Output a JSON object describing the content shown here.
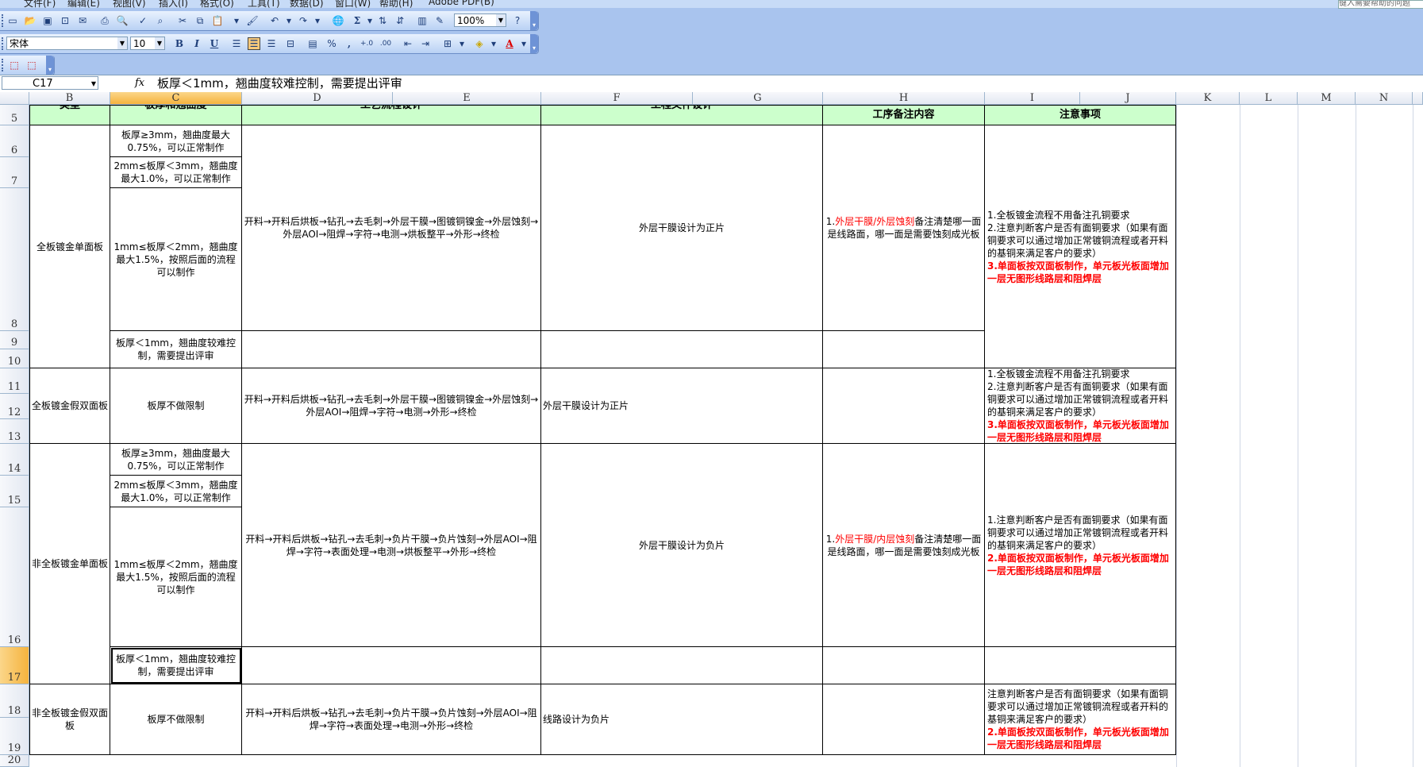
{
  "menu": {
    "items": [
      "文件(F)",
      "编辑(E)",
      "视图(V)",
      "插入(I)",
      "格式(O)",
      "工具(T)",
      "数据(D)",
      "窗口(W)",
      "帮助(H)",
      "Adobe PDF(B)"
    ],
    "help_placeholder": "键入需要帮助的问题"
  },
  "toolbar": {
    "zoom": "100%",
    "font_name": "宋体",
    "font_size": "10",
    "bold": "B",
    "italic": "I",
    "underline": "U",
    "sigma": "Σ",
    "percent": "%",
    "comma": ",",
    "inc_decimal": "+.0",
    "dec_decimal": ".00"
  },
  "formula_bar": {
    "name_box": "C17",
    "fx": "fx",
    "content": "板厚＜1mm，翘曲度较难控制，需要提出评审"
  },
  "columns": [
    "B",
    "C",
    "D",
    "E",
    "F",
    "G",
    "H",
    "I",
    "J",
    "K",
    "L",
    "M",
    "N"
  ],
  "rows": [
    "5",
    "6",
    "7",
    "8",
    "9",
    "10",
    "11",
    "12",
    "13",
    "14",
    "15",
    "16",
    "17",
    "18",
    "19",
    "20"
  ],
  "header": {
    "type": "类型",
    "thickness": "板厚和翘曲度",
    "process": "工艺流程设计",
    "eng": "工程文件设计",
    "remark": "工序备注内容",
    "notes": "注意事项"
  },
  "group1": {
    "type": "全板镀金单面板",
    "t1": "板厚≥3mm，翘曲度最大0.75%，可以正常制作",
    "t2": "2mm≤板厚＜3mm，翘曲度最大1.0%，可以正常制作",
    "t3": "1mm≤板厚＜2mm，翘曲度最大1.5%，按照后面的流程可以制作",
    "t4": "板厚＜1mm，翘曲度较难控制，需要提出评审",
    "process": "开料→开料后烘板→钻孔→去毛刺→外层干膜→图镀铜镍金→外层蚀刻→外层AOI→阻焊→字符→电测→烘板整平→外形→终检",
    "eng": "外层干膜设计为正片",
    "remark_prefix": "1.",
    "remark_red": "外层干膜/外层蚀刻",
    "remark_rest": "备注清楚哪一面是线路面，哪一面是需要蚀刻成光板",
    "note1": "1.全板镀金流程不用备注孔铜要求",
    "note2": "2.注意判断客户是否有面铜要求（如果有面铜要求可以通过增加正常镀铜流程或者开料的基铜来满足客户的要求）",
    "note3": "3.单面板按双面板制作，单元板光板面增加一层无图形线路层和阻焊层"
  },
  "group2": {
    "type": "全板镀金假双面板",
    "t1": "板厚不做限制",
    "process": "开料→开料后烘板→钻孔→去毛刺→外层干膜→图镀铜镍金→外层蚀刻→外层AOI→阻焊→字符→电测→外形→终检",
    "eng": "外层干膜设计为正片",
    "note1": "1.全板镀金流程不用备注孔铜要求",
    "note2": "2.注意判断客户是否有面铜要求（如果有面铜要求可以通过增加正常镀铜流程或者开料的基铜来满足客户的要求）",
    "note3": "3.单面板按双面板制作，单元板光板面增加一层无图形线路层和阻焊层"
  },
  "group3": {
    "type": "非全板镀金单面板",
    "t1": "板厚≥3mm，翘曲度最大0.75%，可以正常制作",
    "t2": "2mm≤板厚＜3mm，翘曲度最大1.0%，可以正常制作",
    "t3": "1mm≤板厚＜2mm，翘曲度最大1.5%，按照后面的流程可以制作",
    "t4": "板厚＜1mm，翘曲度较难控制，需要提出评审",
    "process": "开料→开料后烘板→钻孔→去毛刺→负片干膜→负片蚀刻→外层AOI→阻焊→字符→表面处理→电测→烘板整平→外形→终检",
    "eng": "外层干膜设计为负片",
    "remark_prefix": "1.",
    "remark_red": "外层干膜/内层蚀刻",
    "remark_rest": "备注清楚哪一面是线路面，哪一面是需要蚀刻成光板",
    "note1": "1.注意判断客户是否有面铜要求（如果有面铜要求可以通过增加正常镀铜流程或者开料的基铜来满足客户的要求）",
    "note2": "2.单面板按双面板制作，单元板光板面增加一层无图形线路层和阻焊层"
  },
  "group4": {
    "type": "非全板镀金假双面板",
    "t1": "板厚不做限制",
    "process": "开料→开料后烘板→钻孔→去毛刺→负片干膜→负片蚀刻→外层AOI→阻焊→字符→表面处理→电测→外形→终检",
    "eng": "线路设计为负片",
    "note1": "注意判断客户是否有面铜要求（如果有面铜要求可以通过增加正常镀铜流程或者开料的基铜来满足客户的要求）",
    "note2": "2.单面板按双面板制作，单元板光板面增加一层无图形线路层和阻焊层"
  }
}
